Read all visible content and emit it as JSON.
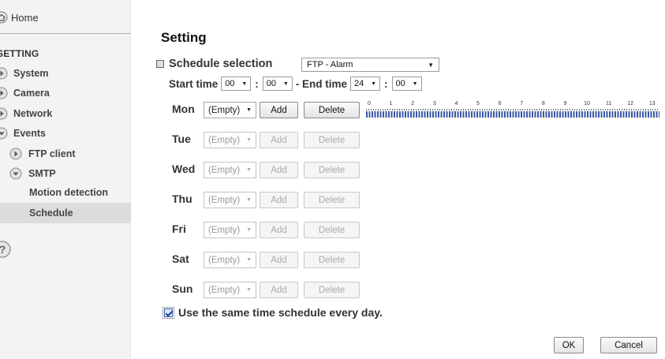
{
  "sidebar": {
    "home_label": "Home",
    "setting_heading": "SETTING",
    "items": [
      {
        "label": "System",
        "icon": "arrow-right-icon"
      },
      {
        "label": "Camera",
        "icon": "arrow-right-icon"
      },
      {
        "label": "Network",
        "icon": "arrow-right-icon"
      },
      {
        "label": "Events",
        "icon": "arrow-down-icon"
      }
    ],
    "sub_items": [
      {
        "label": "FTP client",
        "icon": "arrow-right-icon"
      },
      {
        "label": "SMTP",
        "icon": "arrow-down-icon"
      }
    ],
    "leaf_items": [
      {
        "label": "Motion detection"
      },
      {
        "label": "Schedule",
        "selected": true
      }
    ]
  },
  "main": {
    "title": "Setting",
    "schedule_selection_label": "Schedule selection",
    "schedule_selection_value": "FTP - Alarm",
    "time": {
      "start_label": "Start time",
      "start_hour": "00",
      "start_min": "00",
      "end_label": "- End time",
      "end_hour": "24",
      "end_min": "00",
      "colon": ":"
    },
    "add_label": "Add",
    "delete_label": "Delete",
    "days": [
      {
        "label": "Mon",
        "value": "(Empty)",
        "enabled": true
      },
      {
        "label": "Tue",
        "value": "(Empty)",
        "enabled": false
      },
      {
        "label": "Wed",
        "value": "(Empty)",
        "enabled": false
      },
      {
        "label": "Thu",
        "value": "(Empty)",
        "enabled": false
      },
      {
        "label": "Fri",
        "value": "(Empty)",
        "enabled": false
      },
      {
        "label": "Sat",
        "value": "(Empty)",
        "enabled": false
      },
      {
        "label": "Sun",
        "value": "(Empty)",
        "enabled": false
      }
    ],
    "timeline_ticks": [
      "0",
      "1",
      "2",
      "3",
      "4",
      "5",
      "6",
      "7",
      "8",
      "9",
      "10",
      "11",
      "12",
      "13"
    ],
    "same_schedule_label": "Use the same time schedule every day.",
    "same_schedule_checked": true,
    "ok_label": "OK",
    "cancel_label": "Cancel"
  },
  "colors": {
    "timeline": "#3a57a8",
    "sidebar_bg": "#f3f3f3",
    "selected_bg": "#dcdcdc"
  }
}
